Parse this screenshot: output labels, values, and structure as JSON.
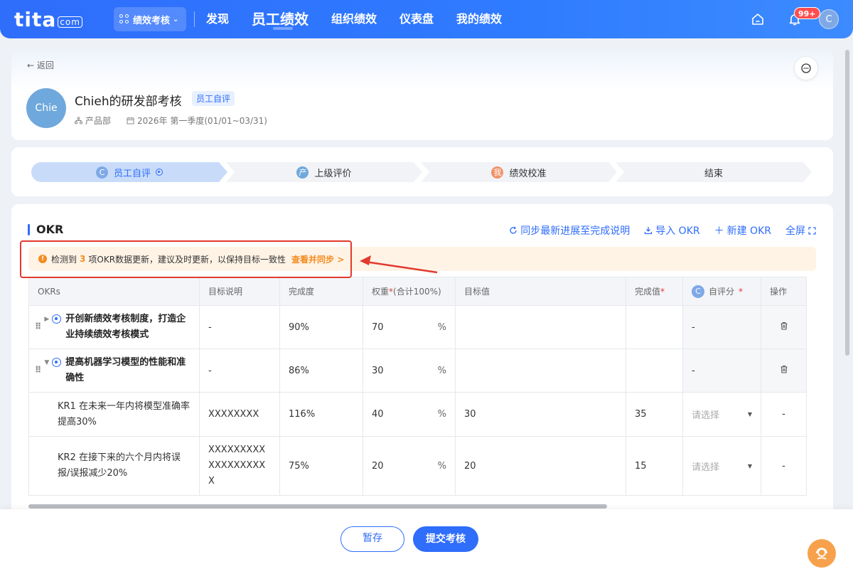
{
  "nav": {
    "logo": "tita",
    "logo_suffix": "com",
    "module": "绩效考核",
    "items": [
      "发现",
      "员工绩效",
      "组织绩效",
      "仪表盘",
      "我的绩效"
    ],
    "notification_count": "99+",
    "user_initial": "C"
  },
  "header": {
    "back": "← 返回",
    "avatar": "Chie",
    "title": "Chieh的研发部考核",
    "role_tag": "员工自评",
    "department": "产品部",
    "period": "2026年 第一季度(01/01~03/31)"
  },
  "steps": [
    {
      "icon": "C",
      "label": "员工自评",
      "color": "#7fa9e6"
    },
    {
      "icon": "产",
      "label": "上级评价",
      "color": "#6fa8dc"
    },
    {
      "icon": "我",
      "label": "绩效校准",
      "color": "#f0926a"
    },
    {
      "icon": "",
      "label": "结束",
      "color": ""
    }
  ],
  "okr": {
    "title": "OKR",
    "actions": {
      "sync": "同步最新进展至完成说明",
      "import": "导入 OKR",
      "create": "新建 OKR",
      "fullscreen": "全屏"
    },
    "alert": {
      "prefix": "检测到",
      "count": "3",
      "text": "项OKR数据更新，建议及时更新，以保持目标一致性",
      "link": "查看并同步 >"
    },
    "columns": {
      "okrs": "OKRs",
      "desc": "目标说明",
      "progress": "完成度",
      "weight": "权重",
      "weight_note": "(合计100%)",
      "target": "目标值",
      "done_value": "完成值",
      "score_icon": "C",
      "score": "自评分",
      "op": "操作"
    },
    "rows": [
      {
        "name": "开创新绩效考核制度，打造企业持续绩效考核模式",
        "desc": "-",
        "progress": "90%",
        "weight": "70",
        "unit": "%",
        "target": "",
        "done": "",
        "score": "-"
      },
      {
        "name": "提高机器学习模型的性能和准确性",
        "desc": "-",
        "progress": "86%",
        "weight": "30",
        "unit": "%",
        "target": "",
        "done": "",
        "score": "-"
      },
      {
        "name": "KR1 在未来一年内将模型准确率提高30%",
        "desc": "XXXXXXXX",
        "progress": "116%",
        "weight": "40",
        "unit": "%",
        "target": "30",
        "done": "35",
        "score": "请选择",
        "op": "-"
      },
      {
        "name": "KR2 在接下来的六个月内将误报/误报减少20%",
        "desc": "XXXXXXXXXXXXXXXXXXX",
        "progress": "75%",
        "weight": "20",
        "unit": "%",
        "target": "20",
        "done": "15",
        "score": "请选择",
        "op": "-"
      }
    ]
  },
  "footer": {
    "save": "暂存",
    "submit": "提交考核"
  },
  "colors": {
    "primary": "#2f6dfb",
    "warning": "#f58b1f",
    "annotation_red": "#e23a2e"
  }
}
